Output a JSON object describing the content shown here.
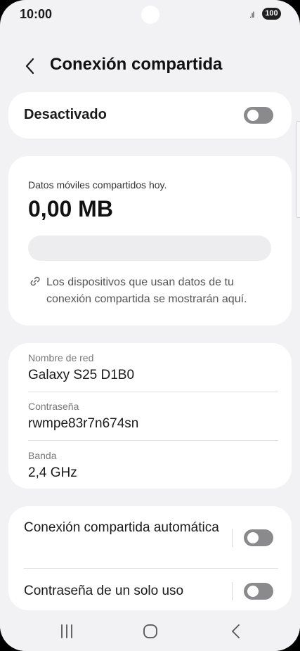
{
  "status_bar": {
    "time": "10:00",
    "signal": ".ıl",
    "battery": "100"
  },
  "header": {
    "title": "Conexión compartida",
    "back_icon": "chevron-left-icon"
  },
  "master_switch": {
    "label": "Desactivado",
    "on": false
  },
  "usage": {
    "label": "Datos móviles compartidos hoy.",
    "value": "0,00 MB",
    "progress": 0,
    "link_icon": "link-icon",
    "note": "Los dispositivos que usan datos de tu conexión compartida se mostrarán aquí."
  },
  "network": {
    "name_label": "Nombre de red",
    "name_value": "Galaxy S25 D1B0",
    "password_label": "Contraseña",
    "password_value": "rwmpe83r7n674sn",
    "band_label": "Banda",
    "band_value": "2,4 GHz"
  },
  "options": {
    "auto_label": "Conexión compartida automática",
    "auto_on": false,
    "otp_label": "Contraseña de un solo uso",
    "otp_on": false
  },
  "nav_bar": {
    "recent_icon": "recent-apps-icon",
    "home_icon": "home-icon",
    "back_icon": "back-arrow-icon"
  },
  "colors": {
    "background": "#f2f2f4",
    "card": "#ffffff",
    "toggle_off": "#8a8a8d",
    "accent": "#3e91ff"
  }
}
